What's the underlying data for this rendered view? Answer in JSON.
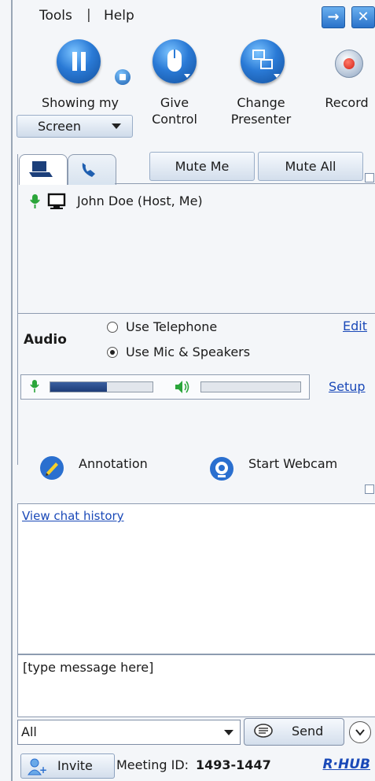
{
  "menu": {
    "tools": "Tools",
    "separator": "|",
    "help": "Help"
  },
  "window_buttons": {
    "pin_icon": "arrow-right-icon",
    "close_icon": "close-icon"
  },
  "toolbar": {
    "showing_label_line1": "Showing my",
    "showing_dropdown_value": "Screen",
    "give_control_line1": "Give",
    "give_control_line2": "Control",
    "change_presenter_line1": "Change",
    "change_presenter_line2": "Presenter",
    "record_label": "Record"
  },
  "participants": {
    "mute_me": "Mute Me",
    "mute_all": "Mute All",
    "list": [
      {
        "name": "John Doe (Host, Me)"
      }
    ]
  },
  "audio": {
    "label": "Audio",
    "option_telephone": "Use Telephone",
    "option_mic": "Use Mic & Speakers",
    "selected": "Use Mic & Speakers",
    "edit": "Edit",
    "setup": "Setup",
    "mic_level": 0.55,
    "speaker_level": 0.0
  },
  "actions": {
    "annotation": "Annotation",
    "webcam": "Start Webcam"
  },
  "chat": {
    "history_link": "View chat history",
    "message_placeholder": "[type message here]",
    "recipient": "All",
    "send": "Send"
  },
  "status": {
    "invite": "Invite",
    "meeting_id_label": "Meeting ID:",
    "meeting_id": "1493-1447",
    "brand": "R·HUB"
  },
  "colors": {
    "accent": "#2a7ad6",
    "link": "#1a49b8",
    "record": "#d21f12"
  }
}
